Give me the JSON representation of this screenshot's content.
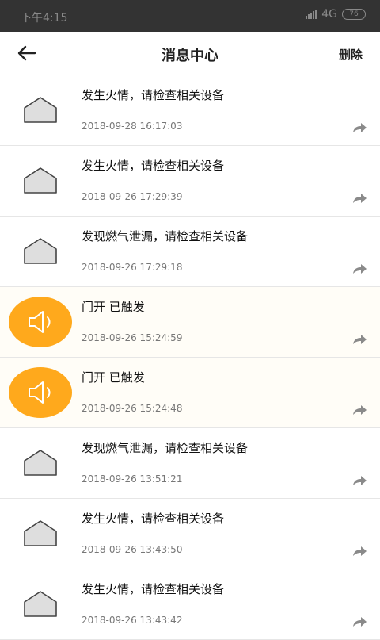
{
  "status_bar": {
    "time": "下午4:15",
    "network": "4G",
    "battery": "76"
  },
  "header": {
    "title": "消息中心",
    "delete_label": "删除"
  },
  "messages": [
    {
      "icon": "home-icon",
      "text": "发生火情，请检查相关设备",
      "time": "2018-09-28 16:17:03"
    },
    {
      "icon": "home-icon",
      "text": "发生火情，请检查相关设备",
      "time": "2018-09-26 17:29:39"
    },
    {
      "icon": "home-icon",
      "text": "发现燃气泄漏，请检查相关设备",
      "time": "2018-09-26 17:29:18"
    },
    {
      "icon": "speaker-icon",
      "text": "门开 已触发",
      "time": "2018-09-26 15:24:59"
    },
    {
      "icon": "speaker-icon",
      "text": "门开 已触发",
      "time": "2018-09-26 15:24:48"
    },
    {
      "icon": "home-icon",
      "text": "发现燃气泄漏，请检查相关设备",
      "time": "2018-09-26 13:51:21"
    },
    {
      "icon": "home-icon",
      "text": "发生火情，请检查相关设备",
      "time": "2018-09-26 13:43:50"
    },
    {
      "icon": "home-icon",
      "text": "发生火情，请检查相关设备",
      "time": "2018-09-26 13:43:42"
    }
  ],
  "colors": {
    "accent_orange": "#ffa91c",
    "status_bar": "#333333"
  }
}
